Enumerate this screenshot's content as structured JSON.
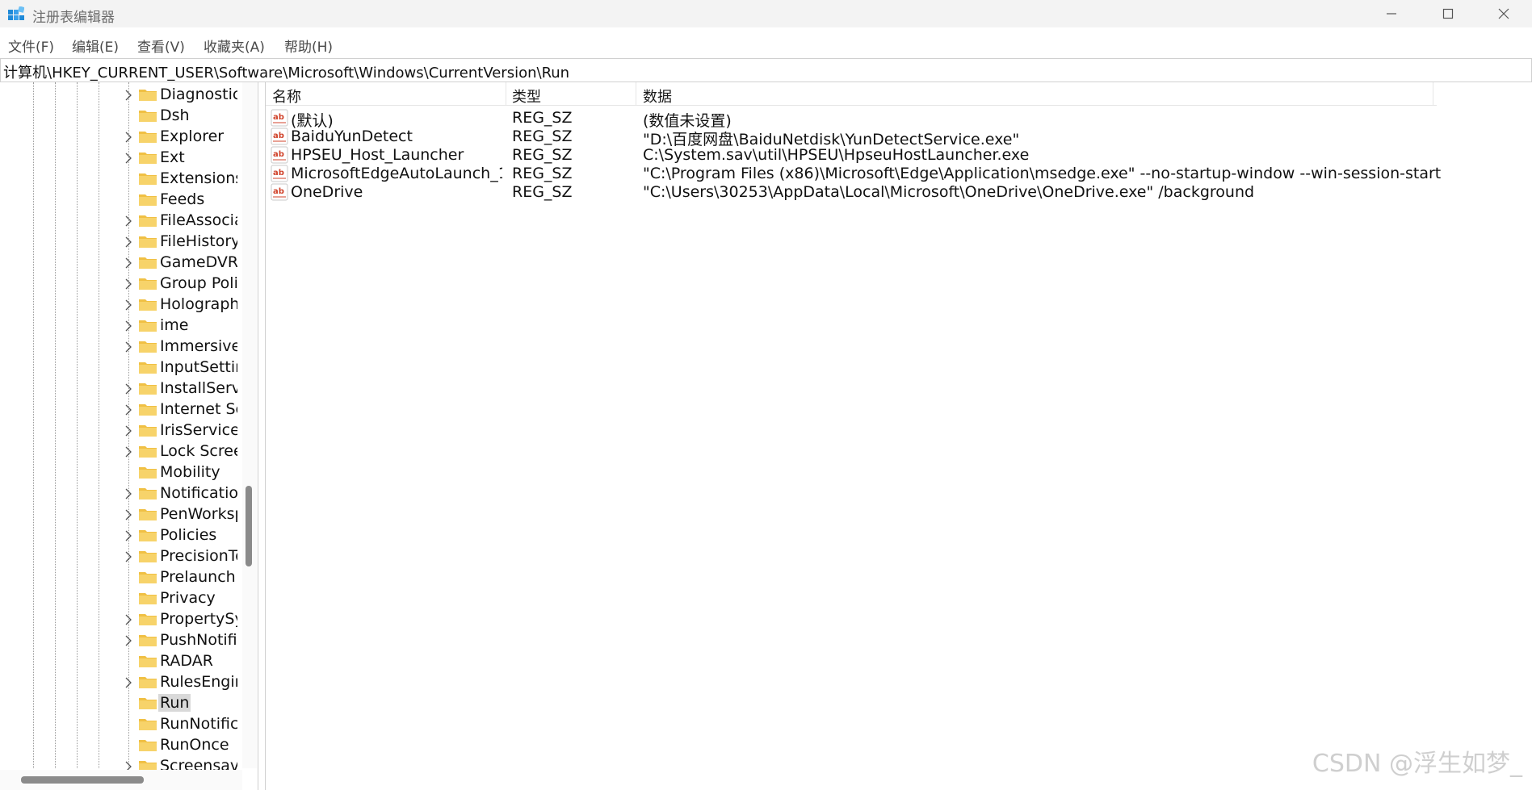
{
  "window": {
    "title": "注册表编辑器"
  },
  "menu": [
    "文件(F)",
    "编辑(E)",
    "查看(V)",
    "收藏夹(A)",
    "帮助(H)"
  ],
  "address": "计算机\\HKEY_CURRENT_USER\\Software\\Microsoft\\Windows\\CurrentVersion\\Run",
  "tree": {
    "items": [
      {
        "label": "Diagnostics",
        "expandable": true
      },
      {
        "label": "Dsh",
        "expandable": false
      },
      {
        "label": "Explorer",
        "expandable": true
      },
      {
        "label": "Ext",
        "expandable": true
      },
      {
        "label": "Extensions",
        "expandable": false
      },
      {
        "label": "Feeds",
        "expandable": false
      },
      {
        "label": "FileAssociations",
        "expandable": true
      },
      {
        "label": "FileHistory",
        "expandable": true
      },
      {
        "label": "GameDVR",
        "expandable": true
      },
      {
        "label": "Group Policy",
        "expandable": true
      },
      {
        "label": "Holographic",
        "expandable": true
      },
      {
        "label": "ime",
        "expandable": true
      },
      {
        "label": "ImmersiveShell",
        "expandable": true
      },
      {
        "label": "InputSettings",
        "expandable": false
      },
      {
        "label": "InstallService",
        "expandable": true
      },
      {
        "label": "Internet Settings",
        "expandable": true
      },
      {
        "label": "IrisService",
        "expandable": true
      },
      {
        "label": "Lock Screen",
        "expandable": true
      },
      {
        "label": "Mobility",
        "expandable": false
      },
      {
        "label": "Notifications",
        "expandable": true
      },
      {
        "label": "PenWorkspace",
        "expandable": true
      },
      {
        "label": "Policies",
        "expandable": true
      },
      {
        "label": "PrecisionTouchPad",
        "expandable": true
      },
      {
        "label": "Prelaunch",
        "expandable": false
      },
      {
        "label": "Privacy",
        "expandable": false
      },
      {
        "label": "PropertySystem",
        "expandable": true
      },
      {
        "label": "PushNotifications",
        "expandable": true
      },
      {
        "label": "RADAR",
        "expandable": false
      },
      {
        "label": "RulesEngine",
        "expandable": true
      },
      {
        "label": "Run",
        "expandable": false,
        "selected": true
      },
      {
        "label": "RunNotification",
        "expandable": false
      },
      {
        "label": "RunOnce",
        "expandable": false
      },
      {
        "label": "Screensavers",
        "expandable": true
      }
    ]
  },
  "list": {
    "headers": {
      "name": "名称",
      "type": "类型",
      "data": "数据"
    },
    "rows": [
      {
        "name": "(默认)",
        "type": "REG_SZ",
        "data": "(数值未设置)"
      },
      {
        "name": "BaiduYunDetect",
        "type": "REG_SZ",
        "data": "\"D:\\百度网盘\\BaiduNetdisk\\YunDetectService.exe\""
      },
      {
        "name": "HPSEU_Host_Launcher",
        "type": "REG_SZ",
        "data": "C:\\System.sav\\util\\HPSEU\\HpseuHostLauncher.exe"
      },
      {
        "name": "MicrosoftEdgeAutoLaunch_1...",
        "type": "REG_SZ",
        "data": "\"C:\\Program Files (x86)\\Microsoft\\Edge\\Application\\msedge.exe\" --no-startup-window --win-session-start"
      },
      {
        "name": "OneDrive",
        "type": "REG_SZ",
        "data": "\"C:\\Users\\30253\\AppData\\Local\\Microsoft\\OneDrive\\OneDrive.exe\" /background"
      }
    ]
  },
  "watermark": "CSDN @浮生如梦_"
}
